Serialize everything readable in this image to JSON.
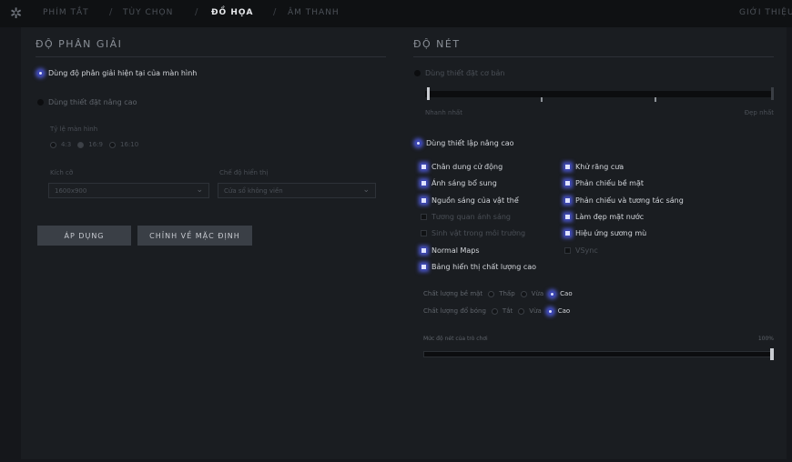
{
  "nav": {
    "tabs": [
      "PHÍM TẮT",
      "TÙY CHỌN",
      "ĐỒ HỌA",
      "ÂM THANH"
    ],
    "separator": "/",
    "right": "GIỚI THIỆU",
    "active_tab": "ĐỒ HỌA"
  },
  "resolution": {
    "title": "ĐỘ PHÂN GIẢI",
    "opt_native": "Dùng độ phân giải hiện tại của màn hình",
    "opt_advanced": "Dùng thiết đặt nâng cao",
    "aspect_label": "Tỷ lệ màn hình",
    "aspect_options": [
      "4:3",
      "16:9",
      "16:10"
    ],
    "aspect_selected": "16:9",
    "size_label": "Kích cỡ",
    "size_value": "1600x900",
    "display_label": "Chế độ hiển thị",
    "display_value": "Cửa sổ không viền",
    "apply": "ÁP DỤNG",
    "reset": "CHỈNH VỀ MẶC ĐỊNH"
  },
  "quality": {
    "title": "ĐỘ NÉT",
    "opt_basic": "Dùng thiết đặt cơ bản",
    "slider_left": "Nhanh nhất",
    "slider_right": "Đẹp nhất",
    "opt_advanced": "Dùng thiết lập nâng cao",
    "checks_left": [
      {
        "label": "Chân dung cử động",
        "on": true
      },
      {
        "label": "Ánh sáng bổ sung",
        "on": true
      },
      {
        "label": "Nguồn sáng của vật thể",
        "on": true
      },
      {
        "label": "Tương quan ánh sáng",
        "on": false
      },
      {
        "label": "Sinh vật trong môi trường",
        "on": false
      },
      {
        "label": "Normal Maps",
        "on": true
      },
      {
        "label": "Bảng hiển thị chất lượng cao",
        "on": true
      }
    ],
    "checks_right": [
      {
        "label": "Khử răng cưa",
        "on": true
      },
      {
        "label": "Phản chiếu bề mặt",
        "on": true
      },
      {
        "label": "Phản chiếu và tương tác sáng",
        "on": true
      },
      {
        "label": "Làm đẹp mặt nước",
        "on": true
      },
      {
        "label": "Hiệu ứng sương mù",
        "on": true
      },
      {
        "label": "VSync",
        "on": false
      }
    ],
    "texture_label": "Chất lượng bề mặt",
    "texture_options": [
      "Thấp",
      "Vừa",
      "Cao"
    ],
    "texture_selected": "Cao",
    "shadow_label": "Chất lượng đổ bóng",
    "shadow_options": [
      "Tắt",
      "Vừa",
      "Cao"
    ],
    "shadow_selected": "Cao",
    "render_label": "Mức độ nét của trò chơi",
    "render_value": "100%",
    "render_fraction": 1.0
  },
  "colors": {
    "accent": "#4a55c8",
    "bg": "#1a1d21"
  }
}
